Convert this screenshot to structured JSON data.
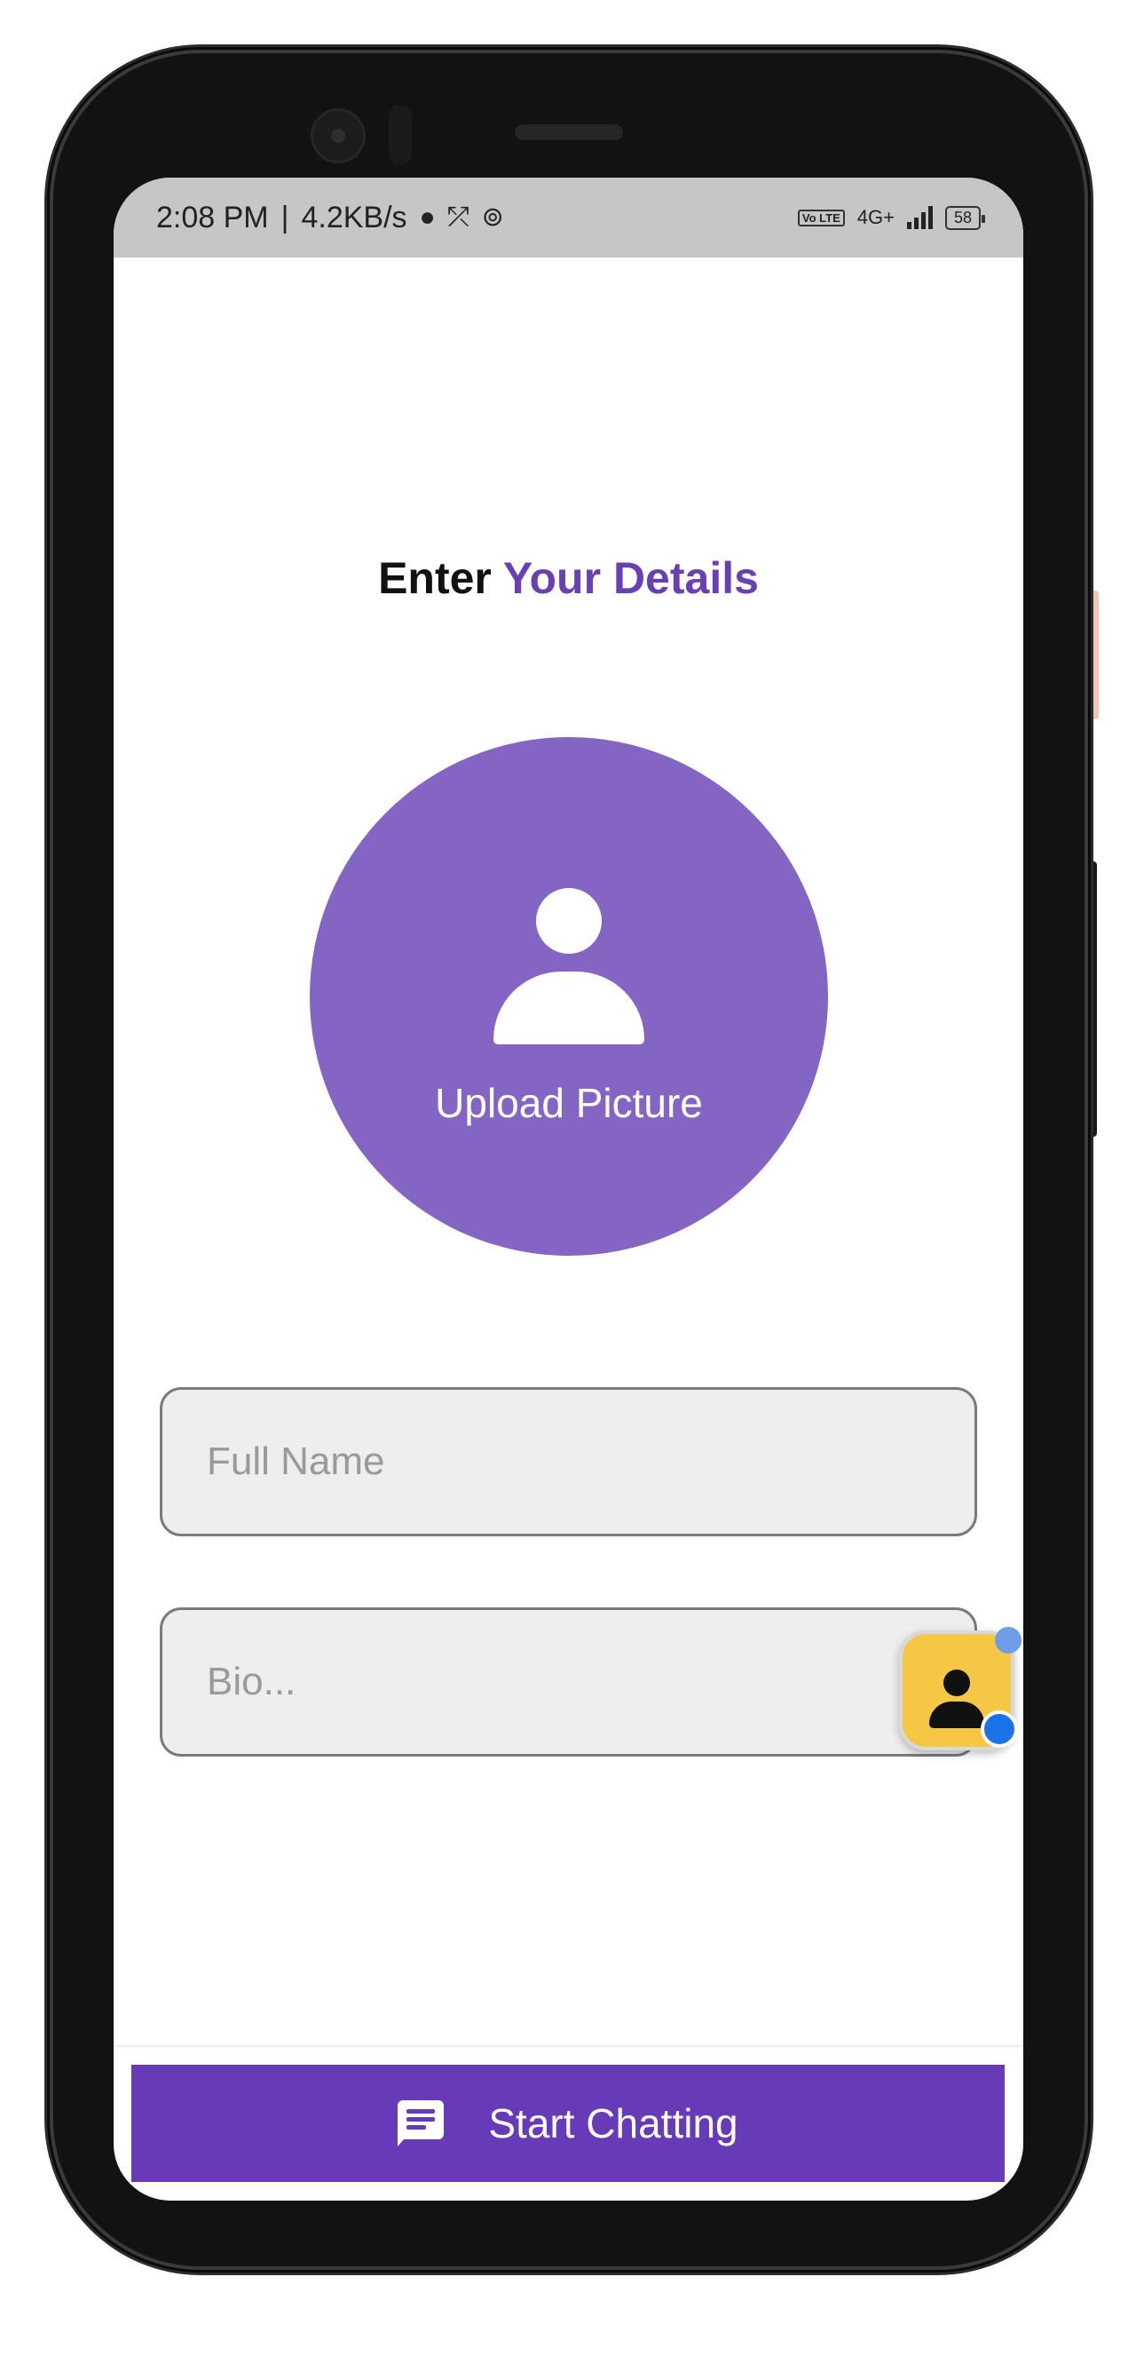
{
  "status_bar": {
    "time": "2:08 PM",
    "speed": "4.2KB/s",
    "network_type": "4G+",
    "volte": "Vo LTE",
    "battery": "58"
  },
  "page": {
    "title_part1": "Enter",
    "title_part2": "Your Details"
  },
  "avatar": {
    "label": "Upload Picture"
  },
  "form": {
    "name_placeholder": "Full Name",
    "name_value": "",
    "bio_placeholder": "Bio...",
    "bio_value": ""
  },
  "footer": {
    "start_label": "Start Chatting"
  },
  "colors": {
    "accent": "#673ab7",
    "avatar_bg": "#8465c3",
    "status_bar_bg": "#c6c6c6",
    "input_bg": "#eeeeee"
  },
  "icons": {
    "avatar": "person-icon",
    "button": "chat-icon"
  }
}
